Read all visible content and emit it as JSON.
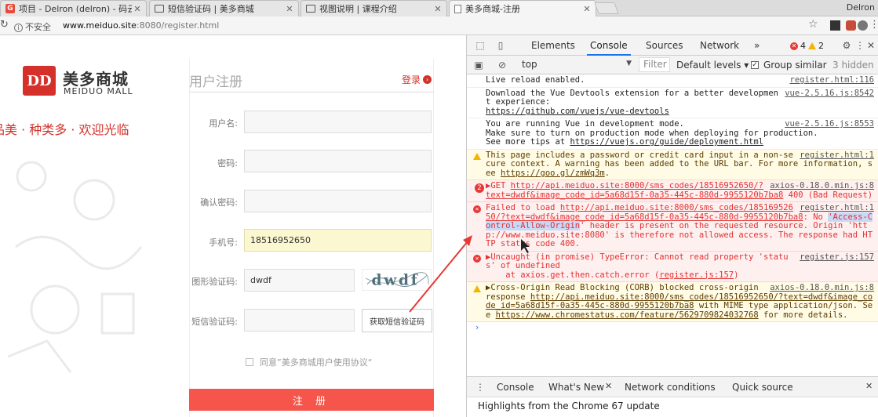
{
  "browser": {
    "tabs": [
      {
        "title": "项目 - Delron (delron) - 码云 G",
        "icon": "gitee-icon"
      },
      {
        "title": "短信验证码 | 美多商城",
        "icon": "book-icon"
      },
      {
        "title": "视图说明 | 课程介绍",
        "icon": "book-icon"
      },
      {
        "title": "美多商城-注册",
        "icon": "document-icon"
      }
    ],
    "profile": "Delron",
    "address": {
      "security_label": "不安全",
      "host": "www.meiduo.site",
      "rest": ":8080/register.html"
    }
  },
  "page": {
    "logo_text": "DD",
    "logo_cn": "美多商城",
    "logo_en": "MEIDUO MALL",
    "slogan": "品美 · 种类多 · 欢迎光临",
    "register_title": "用户注册",
    "login_link": "登录",
    "form": {
      "username_label": "用户名:",
      "username_value": "",
      "password_label": "密码:",
      "password_value": "",
      "confirm_label": "确认密码:",
      "confirm_value": "",
      "mobile_label": "手机号:",
      "mobile_value": "18516952650",
      "captcha_label": "图形验证码:",
      "captcha_value": "dwdf",
      "captcha_image_text": "dwdf",
      "sms_label": "短信验证码:",
      "sms_value": "",
      "sms_button": "获取短信验证码",
      "agree_text": "同意”美多商城用户使用协议“",
      "submit": "注 册"
    }
  },
  "devtools": {
    "tabs": [
      "Elements",
      "Console",
      "Sources",
      "Network"
    ],
    "more": "»",
    "active_tab": "Console",
    "error_count": "4",
    "warning_count": "2",
    "context": "top",
    "filter_placeholder": "Filter",
    "levels": "Default levels ▾",
    "group_similar": "Group similar",
    "hidden_count": "3 hidden",
    "messages": [
      {
        "type": "info",
        "text": "Live reload enabled.",
        "source": "register.html:116"
      },
      {
        "type": "info",
        "text": "Download the Vue Devtools extension for a better development experience:\n",
        "link": "https://github.com/vuejs/vue-devtools",
        "source": "vue-2.5.16.js:8542"
      },
      {
        "type": "info",
        "text": "You are running Vue in development mode.\nMake sure to turn on production mode when deploying for production.\nSee more tips at ",
        "link": "https://vuejs.org/guide/deployment.html",
        "source": "vue-2.5.16.js:8553"
      },
      {
        "type": "warn",
        "text": "This page includes a password or credit card input in a non-secure context. A warning has been added to the URL bar. For more information, see ",
        "link": "https://goo.gl/zmWq3m",
        "tail": ".",
        "source": "register.html:1"
      },
      {
        "type": "err",
        "count": "2",
        "text": "▶GET ",
        "link": "http://api.meiduo.site:8000/sms_codes/18516952650/?text=dwdf&image_code_id=5a68d15f-0a35-445c-880d-9955120b7ba8",
        "tail": " 400 (Bad Request)",
        "source": "axios-0.18.0.min.js:8"
      },
      {
        "type": "err",
        "text": "Failed to load ",
        "link": "http://api.meiduo.site:8000/sms_codes/18516952650/?text=dwdf&image_code_id=5a68d15f-0a35-445c-880d-9955120b7ba8",
        "mid": ": No ",
        "selected": "'Access-Control-Allow-Origin",
        "tail": "' header is present on the requested resource. Origin 'http://www.meiduo.site:8080' is therefore not allowed access. The response had HTTP status code 400.",
        "source": "register.html:1"
      },
      {
        "type": "err",
        "text": "▶Uncaught (in promise) TypeError: Cannot read property 'status' of undefined\n    at axios.get.then.catch.error (",
        "link": "register.js:157",
        "tail": ")",
        "source": "register.js:157"
      },
      {
        "type": "warn",
        "text": "▶Cross-Origin Read Blocking (CORB) blocked cross-origin response ",
        "link": "http://api.meiduo.site:8000/sms_codes/18516952650/?text=dwdf&image_code_id=5a68d15f-0a35-445c-880d-9955120b7ba8",
        "mid": " with MIME type application/json. See ",
        "link2": "https://www.chromestatus.com/feature/5629709824032768",
        "tail": " for more details.",
        "source": "axios-0.18.0.min.js:8"
      }
    ],
    "prompt": "›",
    "drawer_tabs": [
      "Console",
      "What's New",
      "Network conditions",
      "Quick source"
    ],
    "drawer_active": "What's New",
    "drawer_text": "Highlights from the Chrome 67 update"
  },
  "colors": {
    "brand_red": "#d5312b",
    "submit_bg": "#f5554a",
    "error_red": "#e23131",
    "accent_blue": "#1a73e8",
    "annotation_arrow": "#e53935"
  }
}
